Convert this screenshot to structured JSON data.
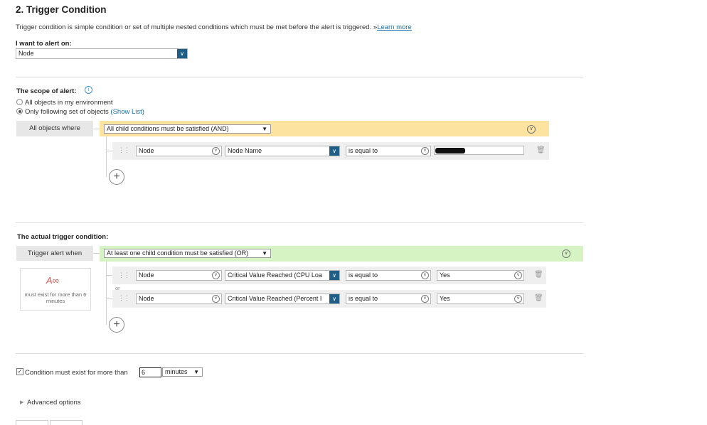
{
  "section": {
    "title": "2. Trigger Condition",
    "description": "Trigger condition is simple condition or set of multiple nested conditions which must be met before the alert is triggered.",
    "learn_more_prefix": "»",
    "learn_more": "Learn more"
  },
  "alert_on": {
    "label": "I want to alert on:",
    "value": "Node"
  },
  "scope": {
    "label": "The scope of alert:",
    "options": [
      {
        "label": "All objects in my environment",
        "selected": false
      },
      {
        "label": "Only following set of objects",
        "selected": true
      }
    ],
    "show_list": "(Show List)",
    "tag": "All objects where",
    "group_select": "All child conditions must be satisfied (AND)",
    "condition": {
      "object": "Node",
      "field": "Node Name",
      "operator": "is equal to",
      "value": ""
    }
  },
  "trigger": {
    "label": "The actual trigger condition:",
    "tag": "Trigger alert when",
    "group_select": "At least one child condition must be satisfied (OR)",
    "note": "must exist for more than 6 minutes",
    "or_label": "or",
    "conditions": [
      {
        "object": "Node",
        "field": "Critical Value Reached (CPU Loa",
        "operator": "is equal to",
        "value": "Yes"
      },
      {
        "object": "Node",
        "field": "Critical Value Reached (Percent I",
        "operator": "is equal to",
        "value": "Yes"
      }
    ]
  },
  "duration": {
    "checked": true,
    "label": "Condition must exist for more than",
    "value": "6",
    "unit": "minutes"
  },
  "advanced": {
    "label": "Advanced options"
  },
  "colors": {
    "and_band": "#fde3a0",
    "or_band": "#d6f3c4",
    "dropdown": "#1f5f86",
    "link": "#1a6fb0"
  }
}
